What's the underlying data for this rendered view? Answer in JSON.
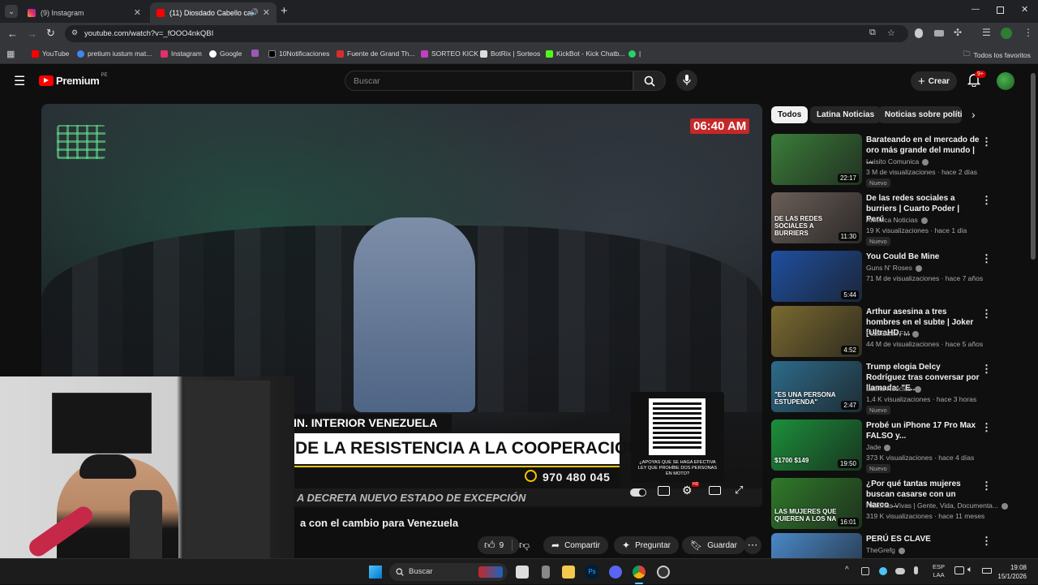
{
  "tabs": [
    {
      "label": "(9) Instagram"
    },
    {
      "label": "(11) Diosdado Cabello cam"
    }
  ],
  "address": {
    "url": "youtube.com/watch?v=_fOOO4nkQBI"
  },
  "bookmarks": [
    {
      "label": "YouTube",
      "color": "#ff0000"
    },
    {
      "label": "pretium iustum mat...",
      "color": "#4285f4"
    },
    {
      "label": "Instagram",
      "color": "#e1306c"
    },
    {
      "label": "Google",
      "color": "#4285f4"
    },
    {
      "label": "",
      "color": "#9b59b6"
    },
    {
      "label": "10Notificaciones",
      "color": "#222"
    },
    {
      "label": "Fuente de Grand Th...",
      "color": "#d32f2f"
    },
    {
      "label": "SORTEO KICK",
      "color": "#c040c0"
    },
    {
      "label": "BotRix | Sorteos",
      "color": "#ddd"
    },
    {
      "label": "KickBot - Kick Chatb...",
      "color": "#53fc18"
    },
    {
      "label": "|",
      "color": "#25d366"
    }
  ],
  "bookmarks_all": "Todos los favoritos",
  "header": {
    "logo": "Premium",
    "region": "PE",
    "search_placeholder": "Buscar",
    "create": "Crear",
    "notif": "9+"
  },
  "chips": [
    "Todos",
    "Latina Noticias",
    "Noticias sobre política"
  ],
  "video": {
    "time": "06:40 AM",
    "ticker1": "IN. INTERIOR VENEZUELA",
    "headline": "DE LA RESISTENCIA A LA COOPERACIÓN",
    "phone": "970 480 045",
    "crawl": "A DECRETA NUEVO ESTADO DE EXCEPCIÓN",
    "qr_text": "¿APOYAS QUE SE HAGA EFECTIVA LEY QUE PROHÍBE DOS PERSONAS EN MOTO?",
    "title": "a con el cambio para Venezuela"
  },
  "actions": {
    "likes": "9",
    "share": "Compartir",
    "ask": "Preguntar",
    "save": "Guardar"
  },
  "recs": [
    {
      "title": "Barateando en el mercado de oro más grande del mundo | ...",
      "channel": "Luisito Comunica",
      "meta": "3 M de visualizaciones · hace 2 días",
      "badge": "Nuevo",
      "duration": "22:17",
      "thumb": "#3b7d3a"
    },
    {
      "title": "De las redes sociales a burriers | Cuarto Poder | Perú",
      "channel": "América Noticias",
      "meta": "19 K visualizaciones · hace 1 día",
      "badge": "Nuevo",
      "duration": "11:30",
      "thumb": "#6a5e58",
      "overlay": "DE LAS REDES SOCIALES A BURRIERS"
    },
    {
      "title": "You Could Be Mine",
      "channel": "Guns N' Roses",
      "meta": "71 M de visualizaciones · hace 7 años",
      "badge": "",
      "duration": "5:44",
      "thumb": "#1f4fa0"
    },
    {
      "title": "Arthur asesina a tres hombres en el subte | Joker [UltraHD, ...",
      "channel": "Flashback FM",
      "meta": "44 M de visualizaciones · hace 5 años",
      "badge": "",
      "duration": "4:52",
      "thumb": "#7a6a30"
    },
    {
      "title": "Trump elogia Delcy Rodríguez tras conversar por llamada: \"E...",
      "channel": "Latina Noticias",
      "meta": "1,4 K visualizaciones · hace 3 horas",
      "badge": "Nuevo",
      "duration": "2:47",
      "thumb": "#2d6b8a",
      "overlay": "\"ES UNA PERSONA ESTUPENDA\""
    },
    {
      "title": "Probé un iPhone 17 Pro Max FALSO y...",
      "channel": "Jade",
      "meta": "373 K visualizaciones · hace 4 días",
      "badge": "Nuevo",
      "duration": "19:50",
      "thumb": "#1b8f3a",
      "overlay": "$1700 $149"
    },
    {
      "title": "¿Por qué tantas mujeres buscan casarse con un Narco ...",
      "channel": "Historias Vivas | Gente, Vida, Documenta...",
      "meta": "319 K visualizaciones · hace 11 meses",
      "badge": "",
      "duration": "16:01",
      "thumb": "#2f7a2a",
      "overlay": "LAS MUJERES QUE QUIEREN A LOS NA"
    },
    {
      "title": "PERÚ ES CLAVE",
      "channel": "TheGrefg",
      "meta": "",
      "badge": "",
      "duration": "",
      "thumb": "#4a88c8"
    }
  ],
  "taskbar": {
    "search": "Buscar",
    "lang1": "ESP",
    "lang2": "LAA",
    "time": "19:08",
    "date": "15/1/2026"
  }
}
